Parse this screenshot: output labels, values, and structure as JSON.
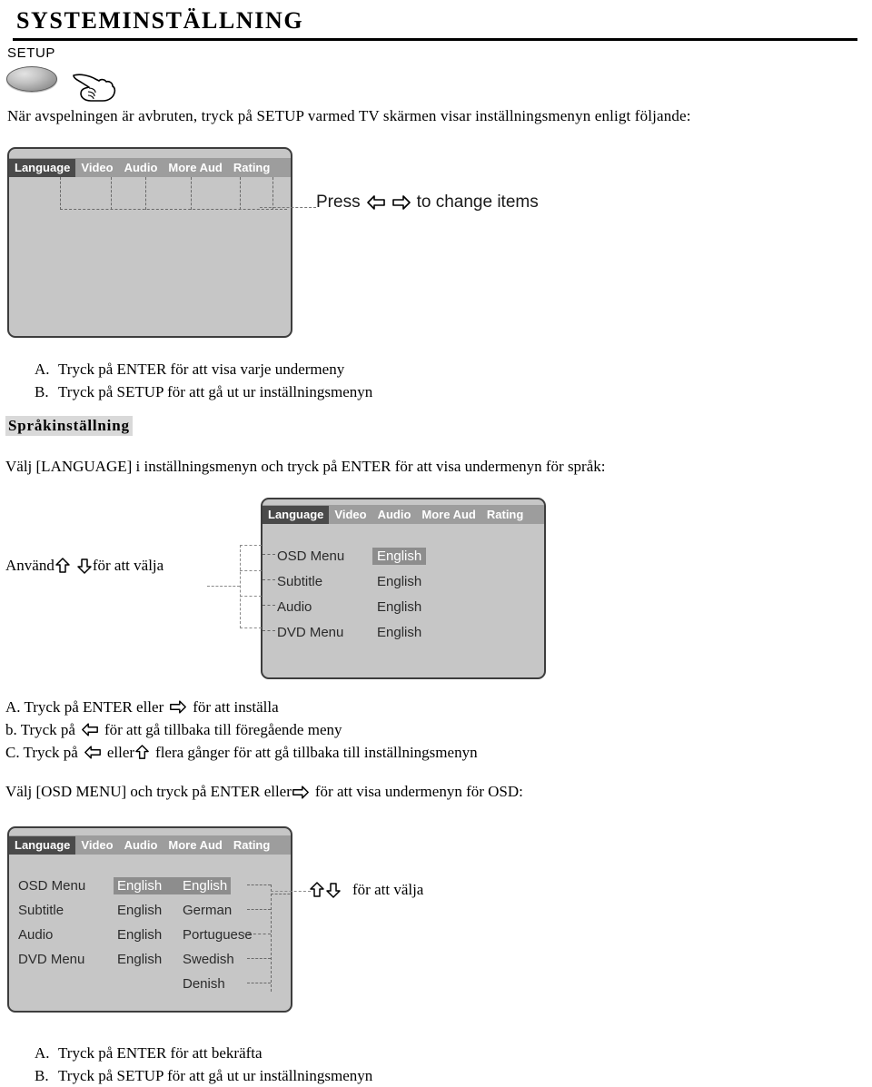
{
  "page": {
    "title": "SYSTEMINSTÄLLNING",
    "setup_label": "SETUP",
    "intro": "När avspelningen är avbruten, tryck på SETUP varmed TV skärmen visar inställningsmenyn enligt följande:"
  },
  "screen1": {
    "tabs": [
      "Language",
      "Video",
      "Audio",
      "More Aud",
      "Rating"
    ],
    "active_tab": "Language",
    "annotation": {
      "prefix": "Press",
      "suffix": "to change items"
    }
  },
  "list1": [
    {
      "marker": "A.",
      "text": "Tryck på ENTER för att visa varje undermeny"
    },
    {
      "marker": "B.",
      "text": "Tryck på SETUP för att gå ut ur inställningsmenyn"
    }
  ],
  "language_section": {
    "heading": "Språkinställning",
    "description": "Välj [LANGUAGE] i inställningsmenyn och tryck på ENTER för att visa undermenyn för språk:"
  },
  "screen2": {
    "tabs": [
      "Language",
      "Video",
      "Audio",
      "More Aud",
      "Rating"
    ],
    "active_tab": "Language",
    "rows": [
      {
        "label": "OSD Menu",
        "value": "English",
        "selected": true
      },
      {
        "label": "Subtitle",
        "value": "English",
        "selected": false
      },
      {
        "label": "Audio",
        "value": "English",
        "selected": false
      },
      {
        "label": "DVD Menu",
        "value": "English",
        "selected": false
      }
    ]
  },
  "use_arrows_annotation": {
    "prefix": "Använd",
    "suffix": "för att välja"
  },
  "list2": [
    {
      "marker": "A. Tryck på ENTER eller",
      "icon": "arrow-right",
      "text": "för att inställa"
    },
    {
      "marker": "b. Tryck på",
      "icon": "arrow-left",
      "text": "för att gå tillbaka till föregående meny"
    },
    {
      "marker": "C. Tryck på",
      "icon": "arrow-left",
      "mid": "eller",
      "icon2": "arrow-up",
      "text": "flera gånger för att gå tillbaka till inställningsmenyn"
    }
  ],
  "osd_description": {
    "prefix": "Välj [OSD MENU] och tryck på ENTER eller",
    "suffix": "för att visa undermenyn för OSD:"
  },
  "screen3": {
    "tabs": [
      "Language",
      "Video",
      "Audio",
      "More Aud",
      "Rating"
    ],
    "active_tab": "Language",
    "rows": [
      {
        "label": "OSD Menu",
        "value": "English",
        "value_selected": true
      },
      {
        "label": "Subtitle",
        "value": "English",
        "value_selected": false
      },
      {
        "label": "Audio",
        "value": "English",
        "value_selected": false
      },
      {
        "label": "DVD Menu",
        "value": "English",
        "value_selected": false
      },
      {
        "label": "",
        "value": "",
        "value_selected": false
      }
    ],
    "options": [
      {
        "text": "English",
        "selected": true
      },
      {
        "text": "German",
        "selected": false
      },
      {
        "text": "Portuguese",
        "selected": false
      },
      {
        "text": "Swedish",
        "selected": false
      },
      {
        "text": "Denish",
        "selected": false
      }
    ]
  },
  "choose_annotation": {
    "text": "för att välja"
  },
  "list3": [
    {
      "marker": "A.",
      "text": "Tryck på ENTER för att bekräfta"
    },
    {
      "marker": "B.",
      "text": "Tryck på SETUP för att gå ut ur inställningsmenyn"
    }
  ],
  "colors": {
    "screen_body": "#c6c6c6",
    "menubar": "#9d9d9d",
    "active_tab": "#4a4a4a",
    "selected_value": "#8d8d8d",
    "heading_highlight": "#d9d9d9"
  }
}
